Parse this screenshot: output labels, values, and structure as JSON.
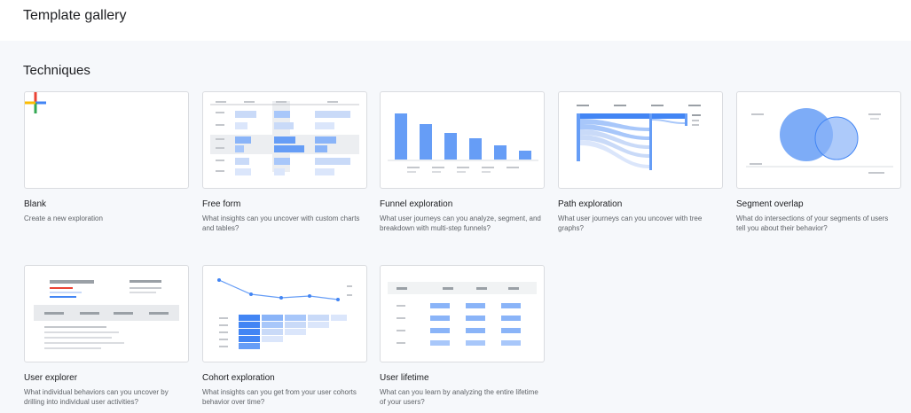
{
  "header": {
    "title": "Template gallery"
  },
  "section": {
    "title": "Techniques"
  },
  "cards": [
    {
      "title": "Blank",
      "description": "Create a new exploration"
    },
    {
      "title": "Free form",
      "description": "What insights can you uncover with custom charts and tables?"
    },
    {
      "title": "Funnel exploration",
      "description": "What user journeys can you analyze, segment, and breakdown with multi-step funnels?"
    },
    {
      "title": "Path exploration",
      "description": "What user journeys can you uncover with tree graphs?"
    },
    {
      "title": "Segment overlap",
      "description": "What do intersections of your segments of users tell you about their behavior?"
    },
    {
      "title": "User explorer",
      "description": "What individual behaviors can you uncover by drilling into individual user activities?"
    },
    {
      "title": "Cohort exploration",
      "description": "What insights can you get from your user cohorts behavior over time?"
    },
    {
      "title": "User lifetime",
      "description": "What can you learn by analyzing the entire lifetime of your users?"
    }
  ],
  "icons": {
    "plus": "plus-icon",
    "colors": {
      "blue": "#4285f4",
      "red": "#ea4335",
      "yellow": "#fbbc04",
      "green": "#34a853"
    }
  }
}
